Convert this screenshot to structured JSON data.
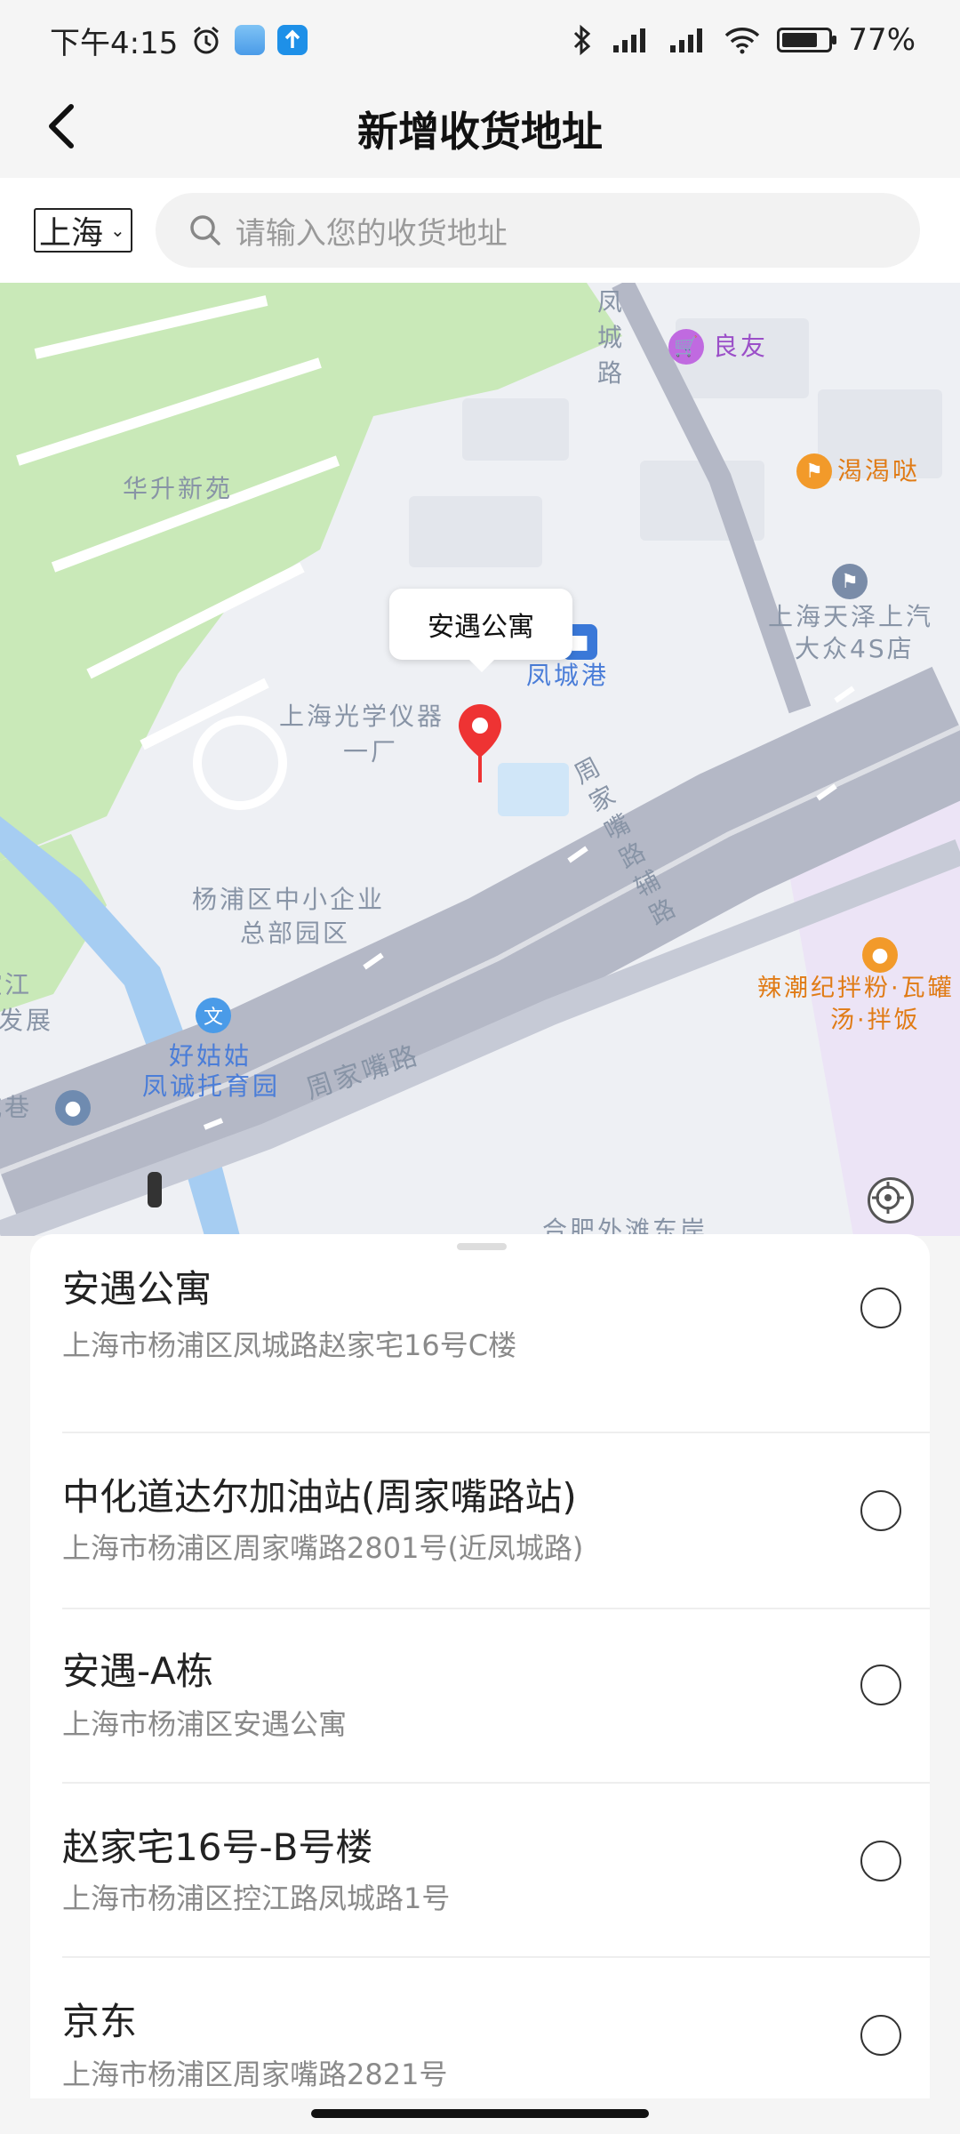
{
  "status_bar": {
    "time": "下午4:15",
    "battery_percent": "77",
    "battery_level": 0.77,
    "icons": [
      "alarm-icon",
      "weather-app-icon",
      "upload-app-icon",
      "bluetooth-icon",
      "signal-icon",
      "signal-icon",
      "wifi-icon",
      "battery-icon"
    ]
  },
  "header": {
    "title": "新增收货地址",
    "back_icon": "chevron-left-icon"
  },
  "search": {
    "city": "上海",
    "placeholder": "请输入您的收货地址"
  },
  "map": {
    "selected_callout": "安遇公寓",
    "pois": {
      "fengcheng_road": "凤城路",
      "liangyou": "良友",
      "kekeda": "渴渴哒",
      "huasheng": "华升新苑",
      "tianze_1": "上海天泽上汽",
      "tianze_2": "大众4S店",
      "guangxue_1": "上海光学仪器",
      "guangxue_2": "一厂",
      "fengchenggang": "凤城港",
      "zhoujiazui_fulu": "周家嘴路辅路",
      "yangpu_1": "杨浦区中小企业",
      "yangpu_2": "总部园区",
      "haogugu_1": "好姑姑",
      "haogugu_2": "凤诚托育园",
      "zhoujiazui_road": "周家嘴路",
      "spicy_1": "辣潮纪拌粉·瓦罐",
      "spicy_2": "汤·拌饭",
      "kongjiang_1": "控江",
      "kongjiang_2": "发展",
      "chengxiang": "城巷",
      "bottom_poi": "合肥外滩东岸"
    },
    "colors": {
      "green": "#c9e9b8",
      "road": "#b4b8c6",
      "water": "#a6cdf2",
      "block": "#e3e6ec",
      "purple_zone": "#ece4f6"
    }
  },
  "addresses": [
    {
      "name": "安遇公寓",
      "detail": "上海市杨浦区凤城路赵家宅16号C楼"
    },
    {
      "name": "中化道达尔加油站(周家嘴路站)",
      "detail": "上海市杨浦区周家嘴路2801号(近凤城路)"
    },
    {
      "name": "安遇-A栋",
      "detail": "上海市杨浦区安遇公寓"
    },
    {
      "name": "赵家宅16号-B号楼",
      "detail": "上海市杨浦区控江路凤城路1号"
    },
    {
      "name": "京东",
      "detail": "上海市杨浦区周家嘴路2821号"
    }
  ]
}
